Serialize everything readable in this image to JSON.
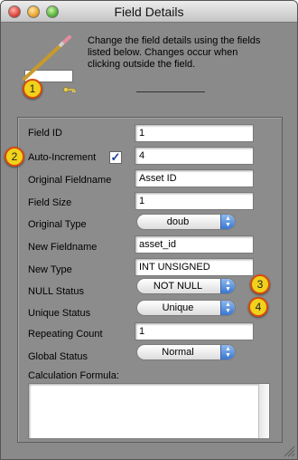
{
  "window": {
    "title": "Field Details"
  },
  "header": {
    "description": "Change the field details using the fields listed below. Changes occur when clicking outside the field.",
    "badge1": "1"
  },
  "fields": {
    "field_id": {
      "label": "Field ID",
      "value": "1"
    },
    "auto_increment": {
      "label": "Auto-Increment",
      "value": "4",
      "checked": true,
      "badge": "2"
    },
    "original_fieldname": {
      "label": "Original Fieldname",
      "value": "Asset ID"
    },
    "field_size": {
      "label": "Field Size",
      "value": "1"
    },
    "original_type": {
      "label": "Original Type",
      "value": "doub"
    },
    "new_fieldname": {
      "label": "New Fieldname",
      "value": "asset_id"
    },
    "new_type": {
      "label": "New Type",
      "value": "INT UNSIGNED"
    },
    "null_status": {
      "label": "NULL Status",
      "value": "NOT NULL",
      "badge": "3"
    },
    "unique_status": {
      "label": "Unique Status",
      "value": "Unique",
      "badge": "4"
    },
    "repeating_count": {
      "label": "Repeating Count",
      "value": "1"
    },
    "global_status": {
      "label": "Global Status",
      "value": "Normal"
    },
    "calculation": {
      "label": "Calculation Formula:",
      "value": ""
    }
  },
  "icons": {
    "pencil": "pencil-icon",
    "key": "key-icon",
    "checkmark": "checkmark-icon"
  },
  "colors": {
    "badge_fill": "#f0d21b",
    "badge_border": "#d84a0d",
    "popup_arrow": "#3a77d0"
  }
}
